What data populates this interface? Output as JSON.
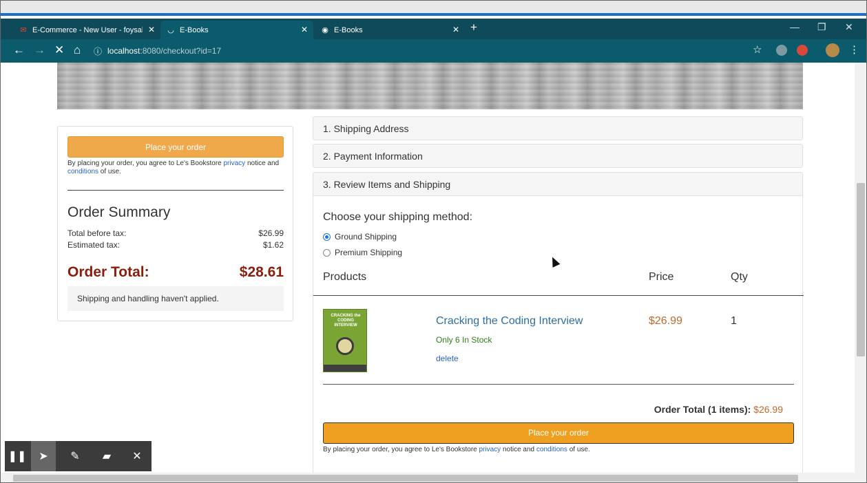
{
  "browser": {
    "tabs": [
      {
        "title": "E-Commerce - New User - foysal",
        "icon": "gmail-icon",
        "active": false
      },
      {
        "title": "E-Books",
        "icon": "loading-icon",
        "active": true
      },
      {
        "title": "E-Books",
        "icon": "globe-icon",
        "active": false
      }
    ],
    "url_host": "localhost",
    "url_path": ":8080/checkout?id=17"
  },
  "summary": {
    "place_order": "Place your order",
    "legal_pre": "By placing your order, you agree to Le's Bookstore ",
    "privacy": "privacy",
    "legal_mid": " notice and ",
    "conditions": "conditions",
    "legal_post": " of use.",
    "title": "Order Summary",
    "total_before_tax_label": "Total before tax:",
    "total_before_tax": "$26.99",
    "estimated_tax_label": "Estimated tax:",
    "estimated_tax": "$1.62",
    "order_total_label": "Order Total:",
    "order_total": "$28.61",
    "shipping_note": "Shipping and handling haven't applied."
  },
  "steps": {
    "shipping": "1. Shipping Address",
    "payment": "2. Payment Information",
    "review": "3. Review Items and Shipping"
  },
  "review": {
    "choose": "Choose your shipping method:",
    "ground": "Ground Shipping",
    "premium": "Premium Shipping",
    "col_products": "Products",
    "col_price": "Price",
    "col_qty": "Qty",
    "cover_title": "CRACKING the CODING INTERVIEW",
    "item_title": "Cracking the Coding Interview",
    "stock": "Only 6 In Stock",
    "delete": "delete",
    "price": "$26.99",
    "qty": "1",
    "order_total_label": "Order Total (1 items):",
    "order_total": "$26.99",
    "place_order": "Place your order",
    "legal_pre": "By placing your order, you agree to Le's Bookstore ",
    "privacy": "privacy",
    "legal_mid": " notice and ",
    "conditions": "conditions",
    "legal_post": " of use."
  }
}
